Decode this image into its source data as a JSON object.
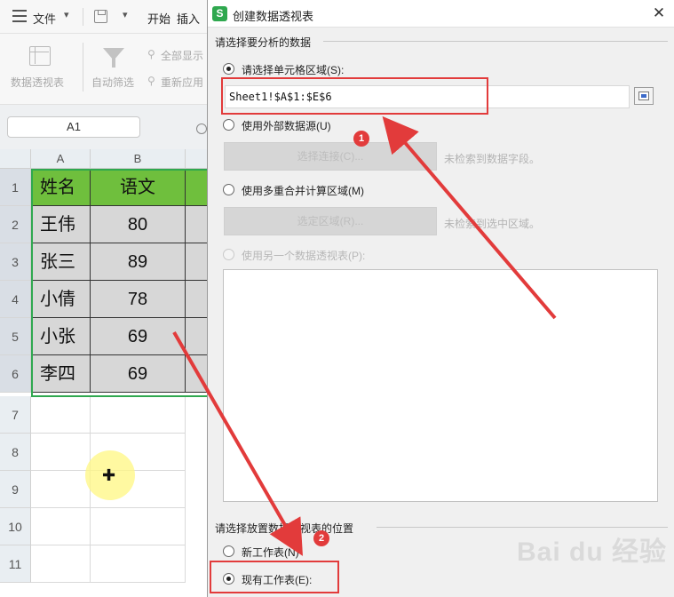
{
  "toolbar": {
    "file_label": "文件",
    "tab_start": "开始",
    "tab_insert": "插入",
    "pivot_label": "数据透视表",
    "autofilter_label": "自动筛选",
    "showall_label": "全部显示",
    "reapply_label": "重新应用"
  },
  "formula": {
    "namebox": "A1"
  },
  "sheet": {
    "columns": [
      "A",
      "B"
    ],
    "rows": [
      "1",
      "2",
      "3",
      "4",
      "5",
      "6",
      "7",
      "8",
      "9",
      "10",
      "11"
    ],
    "table": {
      "header": [
        "姓名",
        "语文"
      ],
      "data": [
        [
          "王伟",
          "80"
        ],
        [
          "张三",
          "89"
        ],
        [
          "小倩",
          "78"
        ],
        [
          "小张",
          "69"
        ],
        [
          "李四",
          "69"
        ]
      ]
    }
  },
  "dialog": {
    "title": "创建数据透视表",
    "close": "✕",
    "section1_title": "请选择要分析的数据",
    "opt_range": "请选择单元格区域(S):",
    "range_value": "Sheet1!$A$1:$E$6",
    "opt_external": "使用外部数据源(U)",
    "btn_connect": "选择连接(C)...",
    "hint_connect": "未检索到数据字段。",
    "opt_multi": "使用多重合并计算区域(M)",
    "btn_region": "选定区域(R)...",
    "hint_region": "未检索到选中区域。",
    "opt_other_pivot": "使用另一个数据透视表(P):",
    "section2_title": "请选择放置数据透视表的位置",
    "opt_new_sheet": "新工作表(N)",
    "opt_existing_sheet": "现有工作表(E):"
  },
  "annotations": {
    "badge1": "1",
    "badge2": "2"
  },
  "watermark": "Bai du 经验",
  "colors": {
    "accent_green": "#2fa84f",
    "header_green": "#6fbf3d",
    "annotation_red": "#e23b3b"
  }
}
